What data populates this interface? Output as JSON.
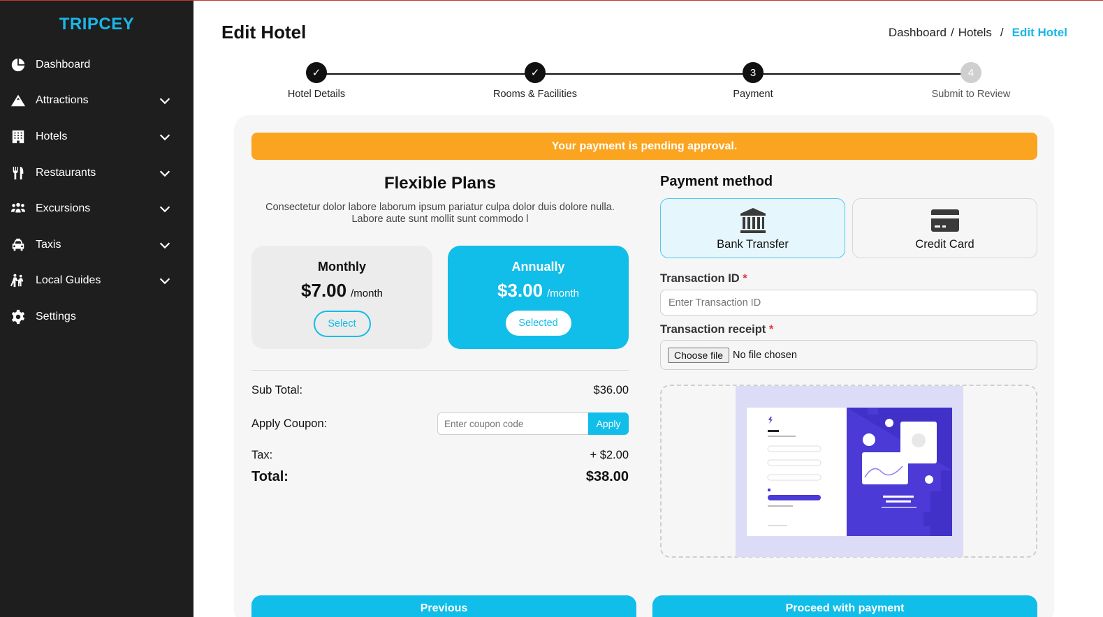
{
  "app": {
    "brand": "TRIPCEY"
  },
  "sidebar": {
    "items": [
      {
        "label": "Dashboard",
        "icon": "pie-chart-icon",
        "expandable": false
      },
      {
        "label": "Attractions",
        "icon": "mountain-icon",
        "expandable": true
      },
      {
        "label": "Hotels",
        "icon": "building-icon",
        "expandable": true
      },
      {
        "label": "Restaurants",
        "icon": "utensils-icon",
        "expandable": true
      },
      {
        "label": "Excursions",
        "icon": "people-group-icon",
        "expandable": true
      },
      {
        "label": "Taxis",
        "icon": "taxi-icon",
        "expandable": true
      },
      {
        "label": "Local Guides",
        "icon": "guide-icon",
        "expandable": true
      },
      {
        "label": "Settings",
        "icon": "gear-icon",
        "expandable": false
      }
    ]
  },
  "header": {
    "title": "Edit Hotel",
    "breadcrumb": {
      "items": [
        "Dashboard",
        "Hotels"
      ],
      "separator": "/",
      "active": "Edit Hotel"
    }
  },
  "stepper": {
    "steps": [
      {
        "label": "Hotel Details",
        "marker": "✓",
        "state": "done"
      },
      {
        "label": "Rooms & Facilities",
        "marker": "✓",
        "state": "done"
      },
      {
        "label": "Payment",
        "marker": "3",
        "state": "current"
      },
      {
        "label": "Submit to Review",
        "marker": "4",
        "state": "todo"
      }
    ]
  },
  "alert": {
    "text": "Your payment is pending approval.",
    "color": "#fba41f"
  },
  "plans": {
    "title": "Flexible Plans",
    "description": "Consectetur dolor labore laborum ipsum pariatur culpa dolor duis dolore nulla. Labore aute sunt mollit sunt commodo l",
    "items": [
      {
        "name": "Monthly",
        "price": "$7.00",
        "period": "/month",
        "button": "Select",
        "selected": false
      },
      {
        "name": "Annually",
        "price": "$3.00",
        "period": "/month",
        "button": "Selected",
        "selected": true
      }
    ]
  },
  "summary": {
    "subtotal_label": "Sub Total:",
    "subtotal_value": "$36.00",
    "coupon_label": "Apply Coupon:",
    "coupon_placeholder": "Enter coupon code",
    "coupon_button": "Apply",
    "tax_label": "Tax:",
    "tax_value": "+ $2.00",
    "total_label": "Total:",
    "total_value": "$38.00"
  },
  "payment": {
    "title": "Payment method",
    "methods": [
      {
        "label": "Bank Transfer",
        "icon": "bank-icon",
        "selected": true
      },
      {
        "label": "Credit Card",
        "icon": "credit-card-icon",
        "selected": false
      }
    ],
    "transaction_id_label": "Transaction ID",
    "transaction_id_placeholder": "Enter Transaction ID",
    "receipt_label": "Transaction receipt",
    "required_mark": "*",
    "file_button": "Choose file",
    "file_status": "No file chosen"
  },
  "actions": {
    "previous": "Previous",
    "proceed": "Proceed with payment"
  },
  "colors": {
    "accent": "#11bde9",
    "sidebar": "#1e1e1e",
    "warning": "#fba41f",
    "required": "#e53935"
  }
}
